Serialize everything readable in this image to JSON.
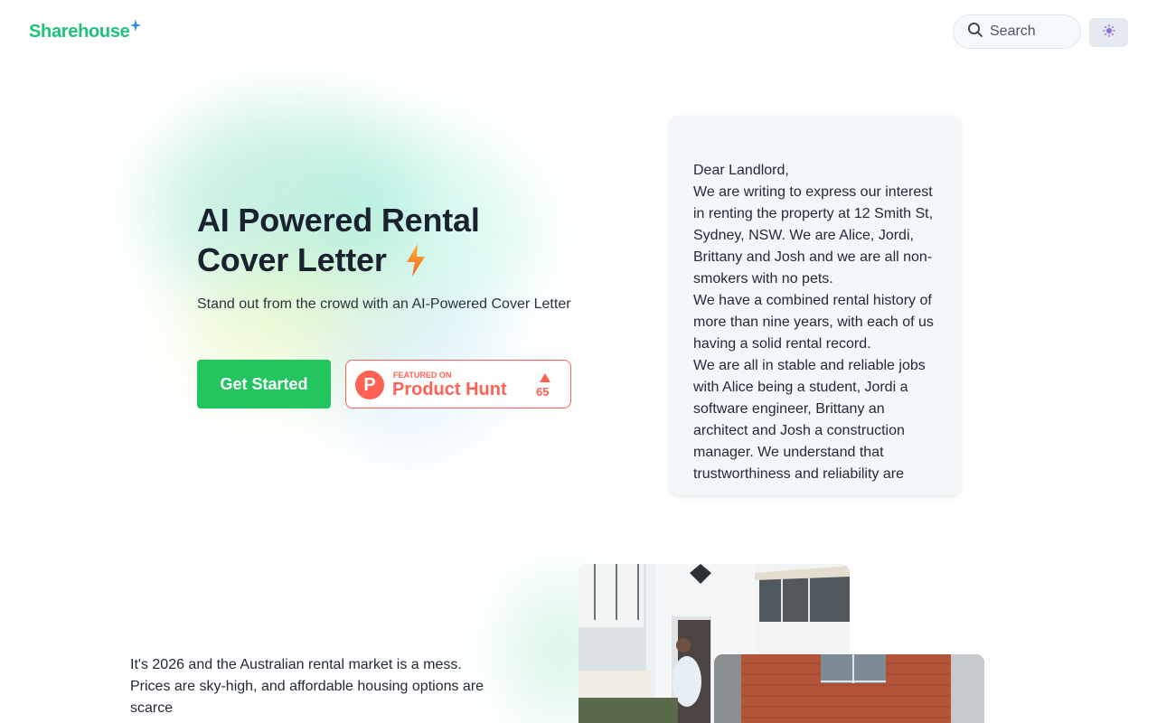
{
  "header": {
    "logo_text": "Sharehouse",
    "search_label": "Search"
  },
  "hero": {
    "title_line1": "AI Powered Rental",
    "title_line2": "Cover Letter",
    "subtitle": "Stand out from the crowd with an AI-Powered Cover Letter",
    "cta_label": "Get Started",
    "product_hunt": {
      "small_label": "FEATURED ON",
      "name": "Product Hunt",
      "logo_letter": "P",
      "votes": "65"
    }
  },
  "letter": {
    "paragraphs": [
      "Dear Landlord,",
      "We are writing to express our interest in renting the property at 12 Smith St, Sydney, NSW. We are Alice, Jordi, Brittany and Josh and we are all non-smokers with no pets.",
      "We have a combined rental history of more than nine years, with each of us having a solid rental record.",
      "We are all in stable and reliable jobs with Alice being a student, Jordi a software engineer, Brittany an architect and Josh a construction manager. We understand that trustworthiness and reliability are"
    ]
  },
  "intro": {
    "text": "It's 2026 and the Australian rental market is a mess. Prices are sky-high, and affordable housing options are scarce"
  },
  "icons": {
    "logo_sparkle": "sparkle-icon",
    "search": "search-icon",
    "theme": "sun-icon",
    "hero": "lightning-bolt-icon"
  },
  "colors": {
    "brand_green": "#1fc27a",
    "cta_green": "#22c55e",
    "product_hunt": "#ff6154",
    "sparkle_blue": "#2b8cf0"
  }
}
